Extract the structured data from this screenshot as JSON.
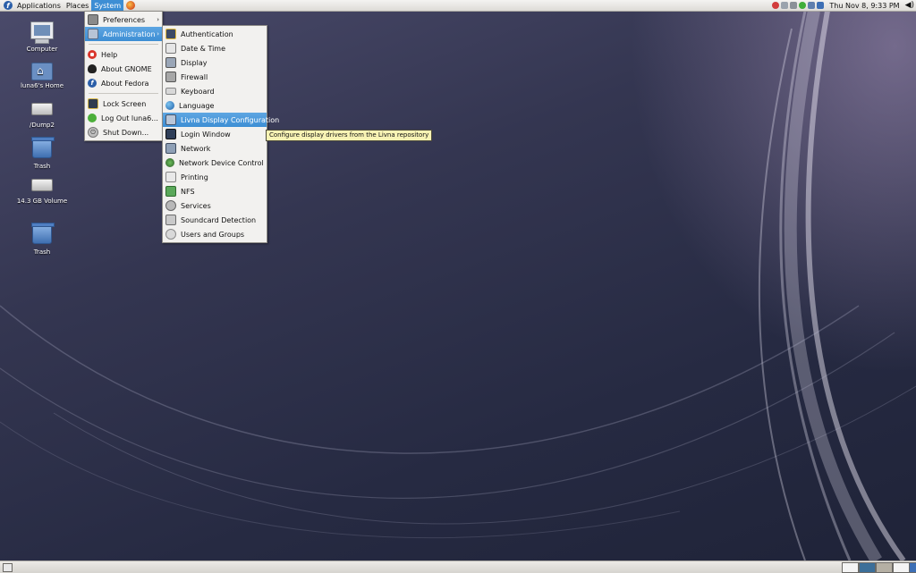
{
  "top_panel": {
    "menus": [
      "Applications",
      "Places",
      "System"
    ],
    "clock": "Thu Nov  8,  9:33 PM"
  },
  "desktop": {
    "icons": [
      {
        "label": "Computer",
        "icon": "computer-icon"
      },
      {
        "label": "luna6's Home",
        "icon": "home-folder-icon"
      },
      {
        "label": "/Dump2",
        "icon": "drive-icon"
      },
      {
        "label": "Trash",
        "icon": "trash-icon"
      },
      {
        "label": "14.3 GB Volume",
        "icon": "drive-icon"
      },
      {
        "label": "Trash",
        "icon": "trash-icon"
      }
    ]
  },
  "system_menu": {
    "items": [
      {
        "label": "Preferences",
        "icon": "preferences-icon",
        "submenu": true
      },
      {
        "label": "Administration",
        "icon": "administration-icon",
        "submenu": true,
        "highlighted": true
      },
      {
        "label": "Help",
        "icon": "help-lifebuoy-icon"
      },
      {
        "label": "About GNOME",
        "icon": "gnome-foot-icon"
      },
      {
        "label": "About Fedora",
        "icon": "fedora-icon"
      },
      {
        "label": "Lock Screen",
        "icon": "lock-screen-icon"
      },
      {
        "label": "Log Out luna6...",
        "icon": "log-out-icon"
      },
      {
        "label": "Shut Down...",
        "icon": "shut-down-icon"
      }
    ]
  },
  "admin_menu": {
    "items": [
      {
        "label": "Authentication",
        "icon": "authentication-icon"
      },
      {
        "label": "Date & Time",
        "icon": "date-time-icon"
      },
      {
        "label": "Display",
        "icon": "display-icon"
      },
      {
        "label": "Firewall",
        "icon": "firewall-icon"
      },
      {
        "label": "Keyboard",
        "icon": "keyboard-icon"
      },
      {
        "label": "Language",
        "icon": "language-globe-icon"
      },
      {
        "label": "Livna Display Configuration",
        "icon": "livna-display-icon",
        "highlighted": true
      },
      {
        "label": "Login Window",
        "icon": "login-window-icon"
      },
      {
        "label": "Network",
        "icon": "network-icon"
      },
      {
        "label": "Network Device Control",
        "icon": "network-device-icon"
      },
      {
        "label": "Printing",
        "icon": "printer-icon"
      },
      {
        "label": "NFS",
        "icon": "nfs-icon"
      },
      {
        "label": "Services",
        "icon": "services-gear-icon"
      },
      {
        "label": "Soundcard Detection",
        "icon": "soundcard-icon"
      },
      {
        "label": "Users and Groups",
        "icon": "users-groups-icon"
      }
    ]
  },
  "tooltip": "Configure display drivers from the Livna repository",
  "colors": {
    "highlight": "#3d8ed4",
    "menu_bg": "#f2f1ef",
    "tooltip_bg": "#f8f3b4",
    "desktop_dark": "#262a42"
  }
}
